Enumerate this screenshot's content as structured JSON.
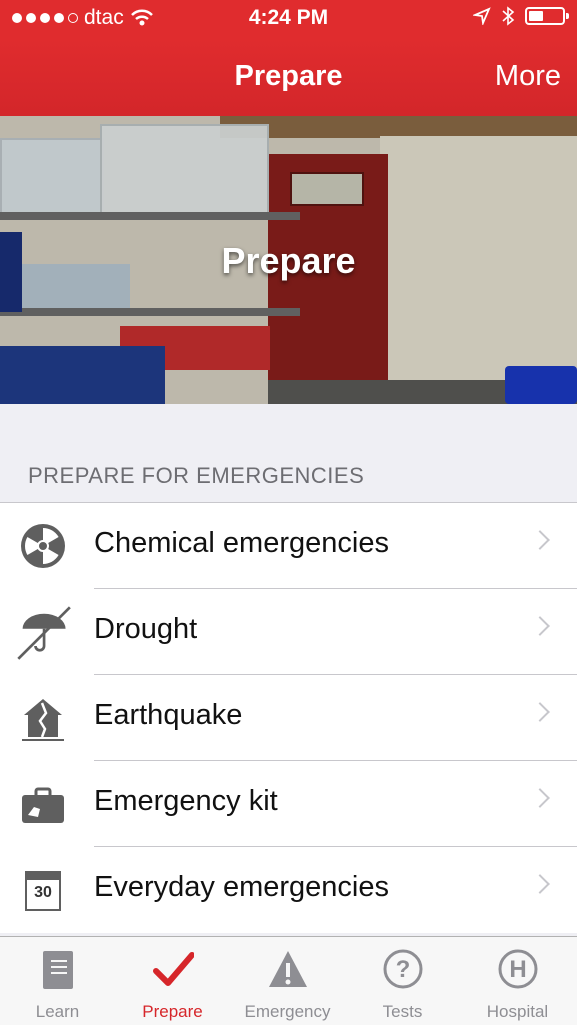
{
  "status_bar": {
    "carrier": "dtac",
    "time": "4:24 PM",
    "signal_icon": "signal-dots-icon",
    "wifi_icon": "wifi-icon",
    "location_icon": "location-arrow-icon",
    "bluetooth_icon": "bluetooth-icon",
    "battery_icon": "battery-icon"
  },
  "navbar": {
    "title": "Prepare",
    "more_label": "More"
  },
  "hero": {
    "label": "Prepare"
  },
  "section": {
    "header": "PREPARE FOR EMERGENCIES"
  },
  "list": [
    {
      "label": "Chemical emergencies",
      "icon": "radiation-icon"
    },
    {
      "label": "Drought",
      "icon": "no-umbrella-icon"
    },
    {
      "label": "Earthquake",
      "icon": "damaged-house-icon"
    },
    {
      "label": "Emergency kit",
      "icon": "kit-bag-icon"
    },
    {
      "label": "Everyday emergencies",
      "icon": "calendar-icon",
      "calendar_day": "30"
    }
  ],
  "tabs": [
    {
      "label": "Learn",
      "icon": "book-icon"
    },
    {
      "label": "Prepare",
      "icon": "checkmark-icon",
      "active": true
    },
    {
      "label": "Emergency",
      "icon": "warning-triangle-icon"
    },
    {
      "label": "Tests",
      "icon": "question-circle-icon"
    },
    {
      "label": "Hospital",
      "icon": "hospital-circle-icon"
    }
  ],
  "colors": {
    "brand_red": "#e02c2e",
    "active_tab": "#d6262a",
    "inactive_tab": "#8e8e93",
    "icon_gray": "#5f5f5f"
  }
}
